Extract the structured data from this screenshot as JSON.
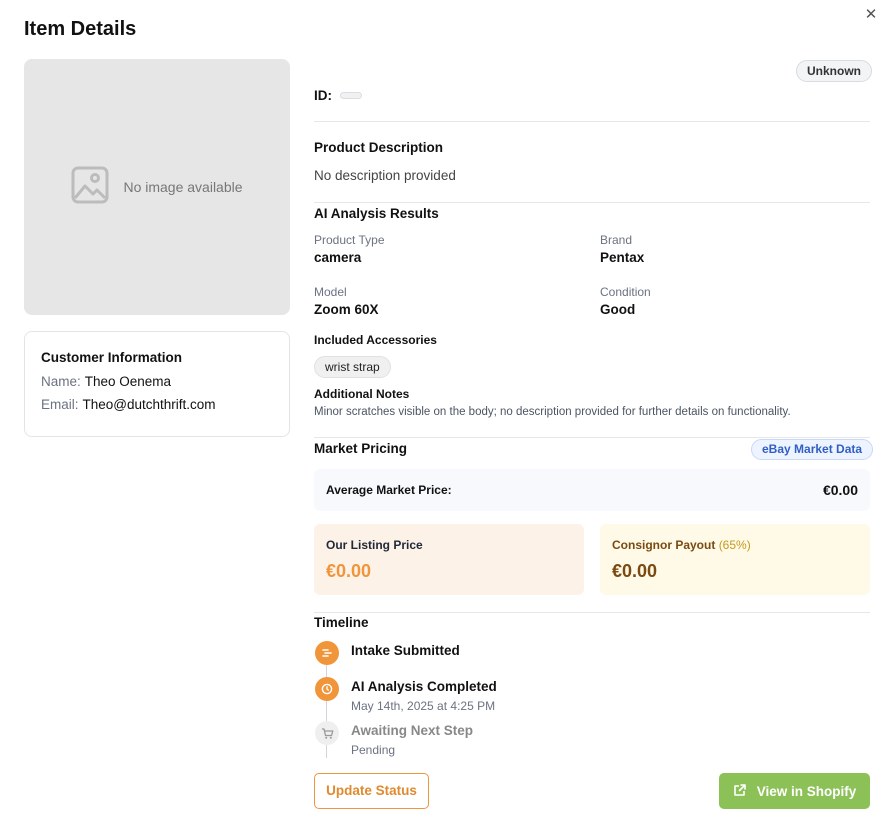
{
  "dialog": {
    "title": "Item Details",
    "close_icon": "✕"
  },
  "image": {
    "placeholder_text": "No image available",
    "icon": "image-placeholder-icon"
  },
  "customer": {
    "heading": "Customer Information",
    "name_label": "Name:",
    "name": "Theo Oenema",
    "email_label": "Email:",
    "email": "Theo@dutchthrift.com"
  },
  "item": {
    "status": "Unknown",
    "id_label": "ID:",
    "id_value": ""
  },
  "description": {
    "heading": "Product Description",
    "text": "No description provided"
  },
  "analysis": {
    "heading": "AI Analysis Results",
    "fields": [
      {
        "label": "Product Type",
        "value": "camera"
      },
      {
        "label": "Brand",
        "value": "Pentax"
      },
      {
        "label": "Model",
        "value": "Zoom 60X"
      },
      {
        "label": "Condition",
        "value": "Good"
      }
    ],
    "accessories_heading": "Included Accessories",
    "accessories": [
      "wrist strap"
    ],
    "notes_heading": "Additional Notes",
    "notes": "Minor scratches visible on the body; no description provided for further details on functionality."
  },
  "pricing": {
    "heading": "Market Pricing",
    "source_badge": "eBay Market Data",
    "average_label": "Average Market Price:",
    "average_value": "€0.00",
    "listing_label": "Our Listing Price",
    "listing_value": "€0.00",
    "payout_label": "Consignor Payout",
    "payout_pct": "(65%)",
    "payout_value": "€0.00"
  },
  "timeline": {
    "heading": "Timeline",
    "steps": [
      {
        "title": "Intake Submitted",
        "sub": "",
        "state": "done"
      },
      {
        "title": "AI Analysis Completed",
        "sub": "May 14th, 2025 at 4:25 PM",
        "state": "done"
      },
      {
        "title": "Awaiting Next Step",
        "sub": "Pending",
        "state": "pending"
      }
    ]
  },
  "actions": {
    "update_label": "Update Status",
    "shopify_label": "View in Shopify"
  },
  "colors": {
    "accent_orange": "#f0953a",
    "shopify_green": "#8cc157",
    "ebay_blue": "#2f5fc4"
  }
}
